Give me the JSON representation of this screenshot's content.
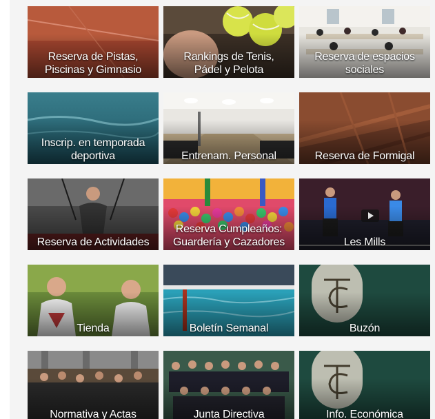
{
  "tiles": [
    {
      "label": "Reserva de Pistas,\nPiscinas y Gimnasio",
      "scene": "court"
    },
    {
      "label": "Rankings de Tenis,\nPádel y Pelota",
      "scene": "tennis-balls"
    },
    {
      "label": "Reserva de espacios\nsociales",
      "scene": "classroom"
    },
    {
      "label": "Inscrip. en temporada\ndeportiva",
      "scene": "swimmer"
    },
    {
      "label": "Entrenam. Personal",
      "scene": "gym"
    },
    {
      "label": "Reserva de Formigal",
      "scene": "wood-roof"
    },
    {
      "label": "Reserva de Actividades",
      "scene": "trx"
    },
    {
      "label": "Reserva Cumpleaños:\nGuardería y Cazadores",
      "scene": "ball-pit"
    },
    {
      "label": "Les Mills",
      "scene": "video"
    },
    {
      "label": "Tienda",
      "scene": "players"
    },
    {
      "label": "Boletín Semanal",
      "scene": "pool"
    },
    {
      "label": "Buzón",
      "scene": "logo"
    },
    {
      "label": "Normativa y Actas",
      "scene": "assembly"
    },
    {
      "label": "Junta Directiva",
      "scene": "board"
    },
    {
      "label": "Info. Económica",
      "scene": "logo"
    }
  ],
  "colors": {
    "page_bg": "#f4f4f4",
    "label_text": "#ffffff",
    "logo_green": "#1e4a3f"
  },
  "icons": {
    "video_play": "play-icon",
    "club_logo": "club-monogram-icon"
  }
}
